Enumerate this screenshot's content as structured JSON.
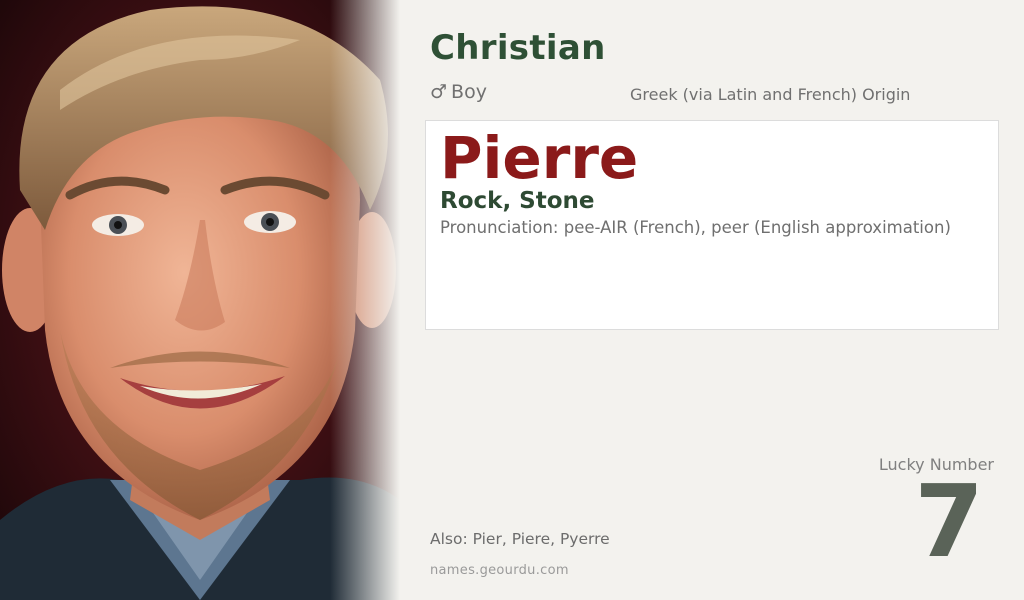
{
  "religion": "Christian",
  "gender": {
    "icon": "male-symbol-icon",
    "icon_glyph": "♂",
    "label": "Boy"
  },
  "origin": "Greek (via Latin and French) Origin",
  "name": "Pierre",
  "meaning": "Rock, Stone",
  "pronunciation": "Pronunciation: pee-AIR (French), peer (English approximation)",
  "lucky": {
    "label": "Lucky Number",
    "number": "7"
  },
  "also": "Also: Pier, Piere, Pyerre",
  "source": "names.geourdu.com",
  "colors": {
    "religion": "#2e5035",
    "name": "#8b1a1a",
    "meaning": "#2e4a33",
    "lucky_number": "#5a6358",
    "background": "#f3f2ee"
  }
}
